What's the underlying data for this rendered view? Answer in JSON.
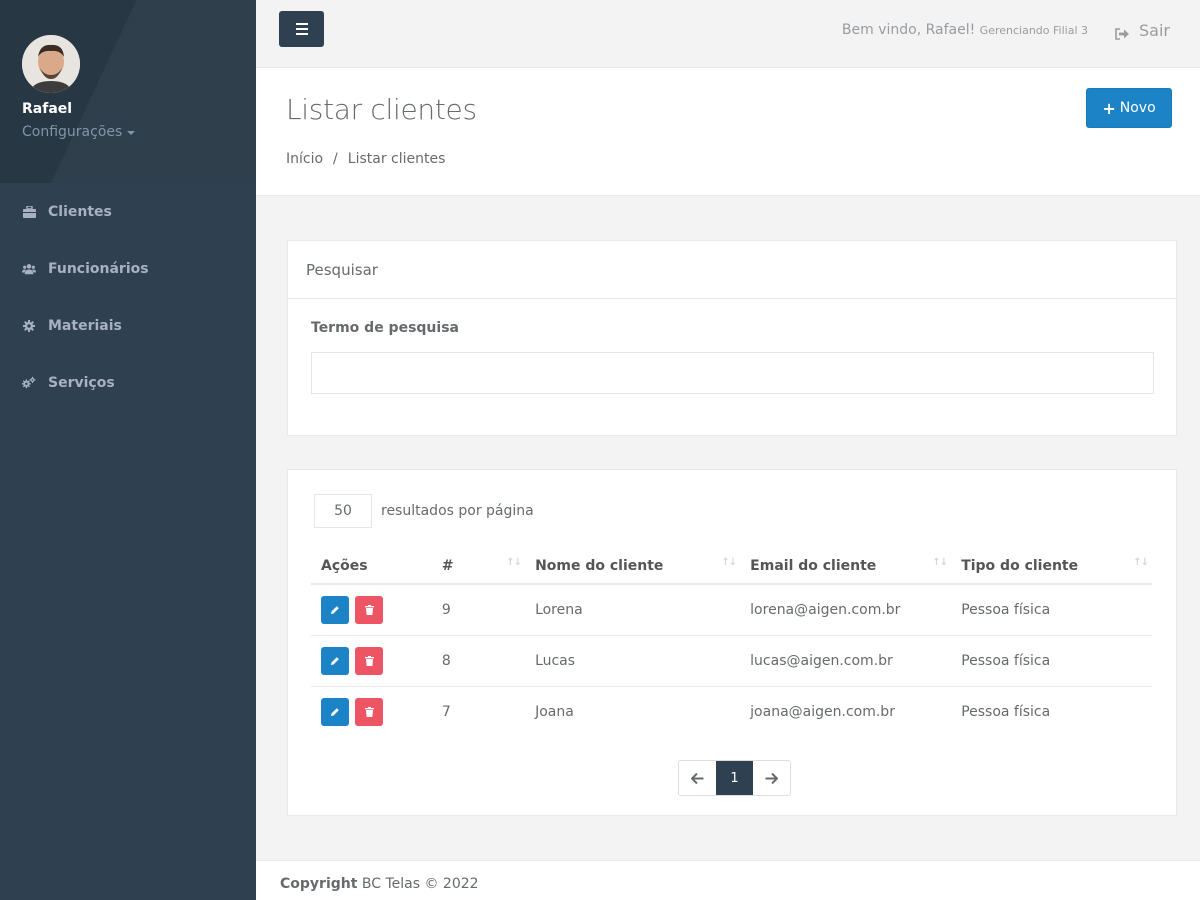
{
  "sidebar": {
    "user_name": "Rafael",
    "user_menu": "Configurações",
    "items": [
      {
        "label": "Clientes",
        "icon": "briefcase-icon"
      },
      {
        "label": "Funcionários",
        "icon": "users-icon"
      },
      {
        "label": "Materiais",
        "icon": "gear-icon"
      },
      {
        "label": "Serviços",
        "icon": "gears-icon"
      }
    ]
  },
  "topbar": {
    "welcome": "Bem vindo, Rafael!",
    "branch": "Gerenciando Filial 3",
    "logout": "Sair"
  },
  "heading": {
    "title": "Listar clientes",
    "breadcrumb": [
      "Início",
      "/",
      "Listar clientes"
    ],
    "new_button": "Novo"
  },
  "search": {
    "panel_title": "Pesquisar",
    "field_label": "Termo de pesquisa",
    "value": "",
    "placeholder": ""
  },
  "table": {
    "per_page": "50",
    "per_page_label": "resultados por página",
    "columns": [
      "Ações",
      "#",
      "Nome do cliente",
      "Email do cliente",
      "Tipo do cliente"
    ],
    "rows": [
      {
        "id": "9",
        "name": "Lorena",
        "email": "lorena@aigen.com.br",
        "type": "Pessoa física"
      },
      {
        "id": "8",
        "name": "Lucas",
        "email": "lucas@aigen.com.br",
        "type": "Pessoa física"
      },
      {
        "id": "7",
        "name": "Joana",
        "email": "joana@aigen.com.br",
        "type": "Pessoa física"
      }
    ],
    "pagination": {
      "current": "1"
    }
  },
  "footer": {
    "copyright_label": "Copyright",
    "copyright_text": "BC Telas © 2022"
  },
  "colors": {
    "sidebar": "#2f4050",
    "primary": "#1c84c6",
    "danger": "#ed5565"
  }
}
